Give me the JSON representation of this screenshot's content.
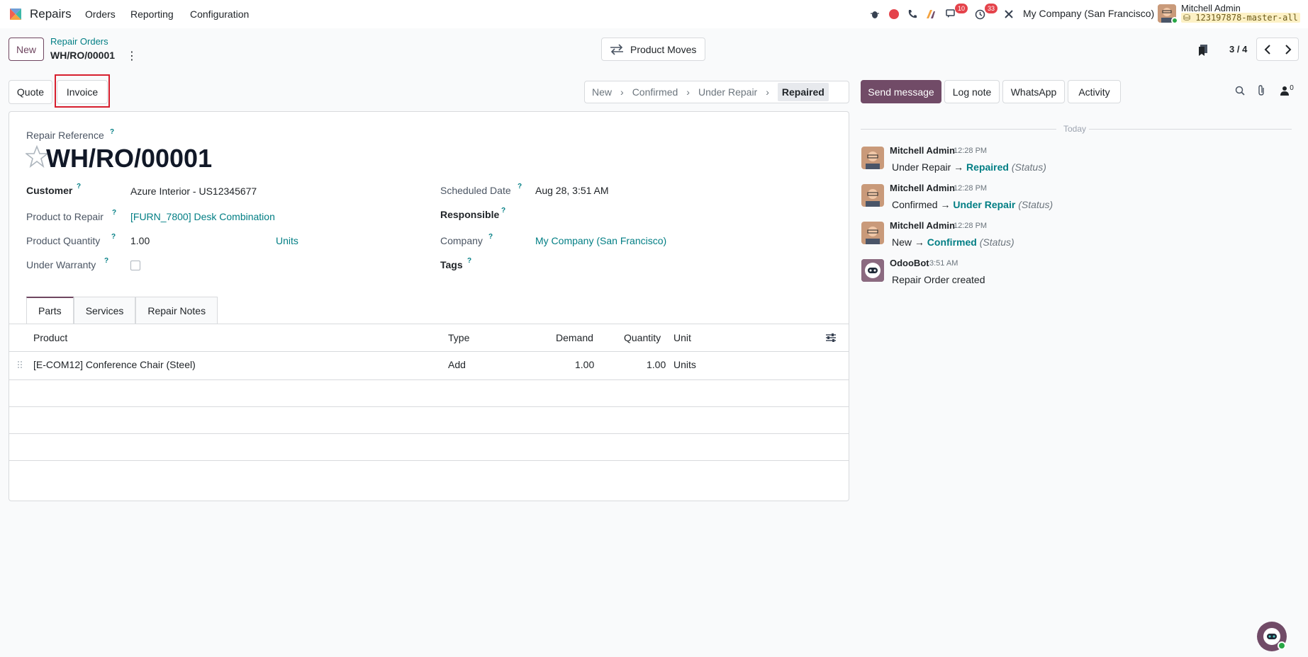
{
  "navbar": {
    "app_name": "Repairs",
    "menus": [
      "Orders",
      "Reporting",
      "Configuration"
    ],
    "messages_badge": "10",
    "activities_badge": "33",
    "company": "My Company (San Francisco)",
    "user_name": "Mitchell Admin",
    "db_name": "123197878-master-all"
  },
  "control_panel": {
    "new_label": "New",
    "breadcrumb_parent": "Repair Orders",
    "breadcrumb_current": "WH/RO/00001",
    "kebab": "⋮",
    "product_moves_label": "Product Moves",
    "pager_value": "3 / 4"
  },
  "actions": {
    "quote_label": "Quote",
    "invoice_label": "Invoice"
  },
  "statusbar": {
    "stages": [
      "New",
      "Confirmed",
      "Under Repair",
      "Repaired"
    ],
    "active_stage": "Repaired"
  },
  "form": {
    "ref_label": "Repair Reference",
    "ref_value": "WH/RO/00001",
    "customer_label": "Customer",
    "customer_value": "Azure Interior - US12345677",
    "product_label": "Product to Repair",
    "product_value": "[FURN_7800] Desk Combination",
    "quantity_label": "Product Quantity",
    "quantity_value": "1.00",
    "quantity_unit": "Units",
    "warranty_label": "Under Warranty",
    "scheduled_label": "Scheduled Date",
    "scheduled_value": "Aug 28, 3:51 AM",
    "responsible_label": "Responsible",
    "company_label": "Company",
    "company_value": "My Company (San Francisco)",
    "tags_label": "Tags",
    "help_mark": "?"
  },
  "tabs": [
    "Parts",
    "Services",
    "Repair Notes"
  ],
  "parts_table": {
    "headers": [
      "Product",
      "Type",
      "Demand",
      "Quantity",
      "Unit"
    ],
    "rows": [
      {
        "product": "[E-COM12] Conference Chair (Steel)",
        "type": "Add",
        "demand": "1.00",
        "quantity": "1.00",
        "unit": "Units"
      }
    ]
  },
  "chatter": {
    "send_message_label": "Send message",
    "log_note_label": "Log note",
    "whatsapp_label": "WhatsApp",
    "activity_label": "Activity",
    "followers_count": "0",
    "today_label": "Today",
    "messages": [
      {
        "author": "Mitchell Admin",
        "time": "12:28 PM",
        "old": "Under Repair",
        "new": "Repaired",
        "field": "(Status)"
      },
      {
        "author": "Mitchell Admin",
        "time": "12:28 PM",
        "old": "Confirmed",
        "new": "Under Repair",
        "field": "(Status)"
      },
      {
        "author": "Mitchell Admin",
        "time": "12:28 PM",
        "old": "New",
        "new": "Confirmed",
        "field": "(Status)"
      },
      {
        "author": "OdooBot",
        "time": "3:51 AM",
        "text": "Repair Order created"
      }
    ],
    "arrow": "→"
  },
  "colors": {
    "brand": "#714b67",
    "link": "#017e84",
    "highlight": "#d71f2e"
  }
}
